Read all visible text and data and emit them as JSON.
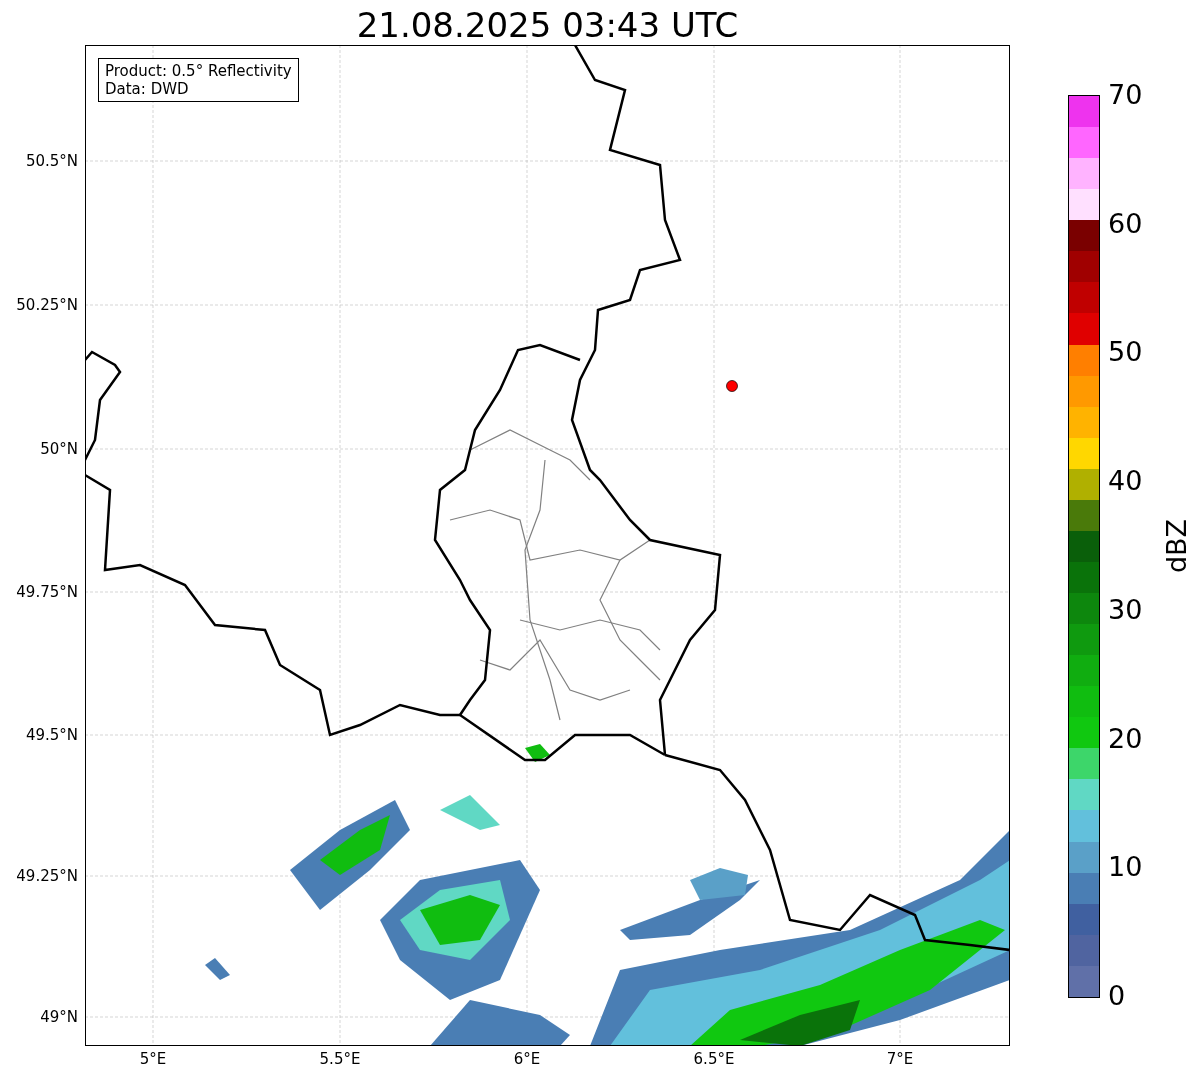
{
  "title": "21.08.2025 03:43 UTC",
  "info_box": [
    "Product: 0.5° Reflectivity",
    "Data: DWD"
  ],
  "y_ticks": [
    "50.5°N",
    "50.25°N",
    "50°N",
    "49.75°N",
    "49.5°N",
    "49.25°N",
    "49°N"
  ],
  "x_ticks": [
    "5°E",
    "5.5°E",
    "6°E",
    "6.5°E",
    "7°E"
  ],
  "colorbar": {
    "label": "dBZ",
    "ticks": [
      "70",
      "60",
      "50",
      "40",
      "30",
      "20",
      "10",
      "0"
    ],
    "segments": [
      {
        "color": "#6070a8"
      },
      {
        "color": "#5064a0"
      },
      {
        "color": "#4060a0"
      },
      {
        "color": "#4a7eb4"
      },
      {
        "color": "#5aa0c8"
      },
      {
        "color": "#62c0dc"
      },
      {
        "color": "#60d8c4"
      },
      {
        "color": "#3dd66a"
      },
      {
        "color": "#10c810"
      },
      {
        "color": "#10bd10"
      },
      {
        "color": "#10ad10"
      },
      {
        "color": "#0f9a0f"
      },
      {
        "color": "#0d870d"
      },
      {
        "color": "#0a730a"
      },
      {
        "color": "#0a5f0a"
      },
      {
        "color": "#4a7a0a"
      },
      {
        "color": "#b0b000"
      },
      {
        "color": "#ffd700"
      },
      {
        "color": "#ffb300"
      },
      {
        "color": "#ff9900"
      },
      {
        "color": "#ff7f00"
      },
      {
        "color": "#e00000"
      },
      {
        "color": "#c00000"
      },
      {
        "color": "#a00000"
      },
      {
        "color": "#7a0000"
      },
      {
        "color": "#ffe0ff"
      },
      {
        "color": "#ffb3ff"
      },
      {
        "color": "#ff66ff"
      },
      {
        "color": "#ee33ee"
      }
    ]
  }
}
